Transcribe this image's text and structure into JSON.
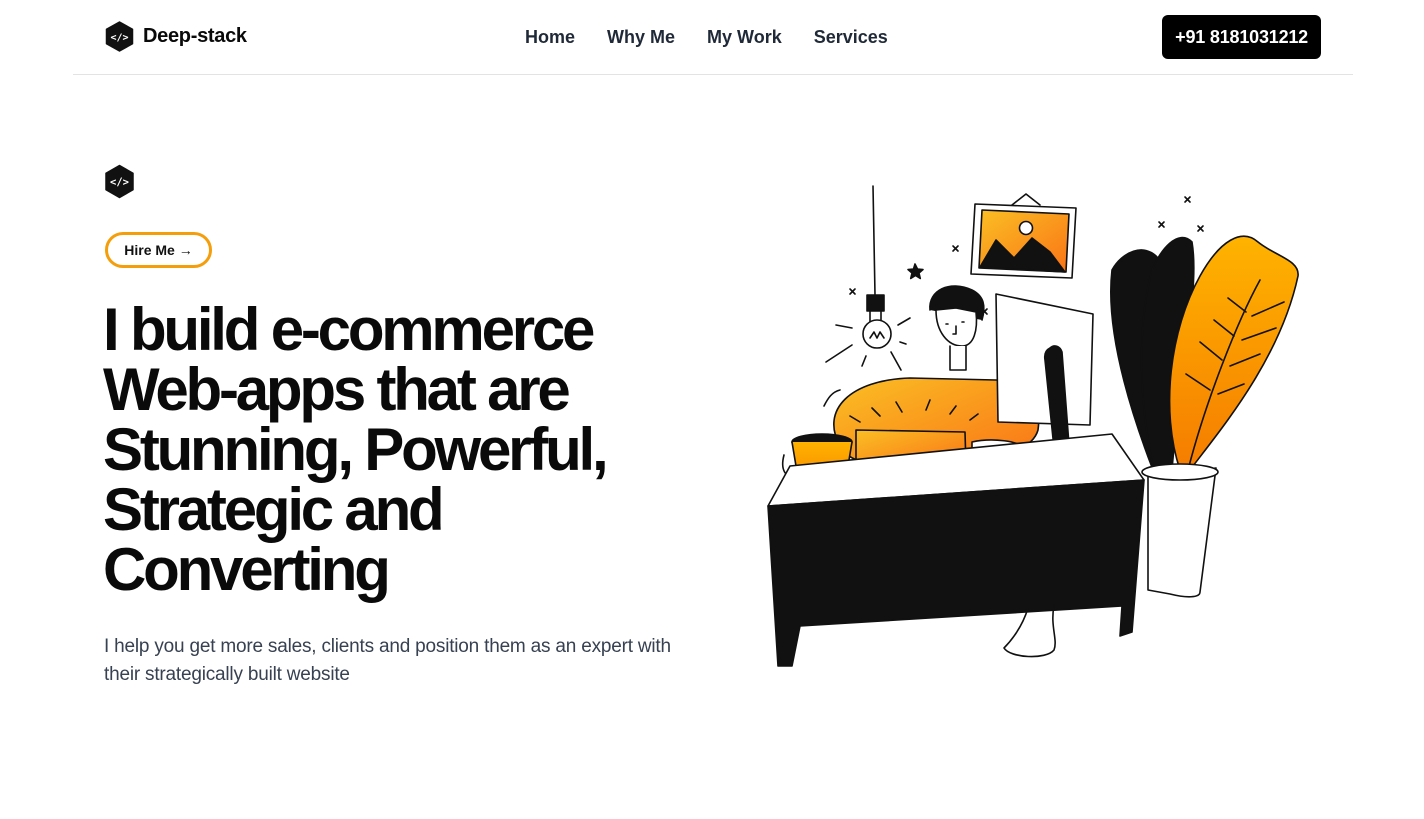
{
  "header": {
    "brand": {
      "name": "Deep-stack",
      "logo_icon": "code-hexagon-icon"
    },
    "nav": [
      {
        "label": "Home"
      },
      {
        "label": "Why Me"
      },
      {
        "label": "My Work"
      },
      {
        "label": "Services"
      }
    ],
    "phone_button": "+91 8181031212"
  },
  "hero": {
    "logo_icon": "code-hexagon-icon",
    "hire_button": "Hire Me →",
    "headline": "I build e-commerce Web-apps that are Stunning, Powerful, Strategic and Converting",
    "subtext": "I help you get more sales, clients and position them as an expert with their strategically built website",
    "illustration": "developer-at-desk-illustration"
  },
  "colors": {
    "accent": "#f59e0b",
    "orange": "#f97316",
    "dark": "#0a0a0a",
    "text_gray": "#374151"
  }
}
